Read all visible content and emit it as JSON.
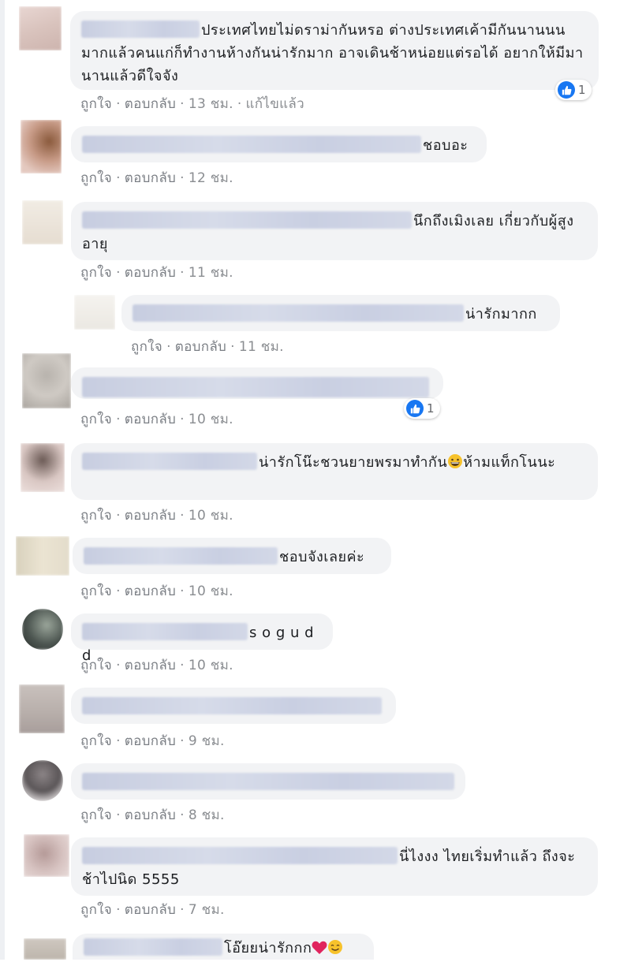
{
  "comments": [
    {
      "text": "ประเทศไทยไม่ดราม่ากันหรอ ต่างประเทศเค้ามีกันนานนน มากแล้วคนแก่ก็ทำงานห้างกันน่ารักมาก อาจเดินช้าหน่อยแต่รอได้ อยากให้มีมานานแล้วดีใจจัง",
      "time": "13 ชม.",
      "edited": "แก้ไขแล้ว",
      "reactions": "1"
    },
    {
      "text": "ชอบอะ",
      "time": "12 ชม."
    },
    {
      "text": "นึกถึงเมิงเลย เกี่ยวกับผู้สูงอายุ",
      "time": "11 ชม."
    },
    {
      "text": "น่ารักมากก",
      "time": "11 ชม."
    },
    {
      "text": "",
      "time": "10 ชม.",
      "reactions": "1"
    },
    {
      "text_before": "น่ารักโน๊ะชวนยายพรมาทำกัน",
      "text_after": "ห้ามแท็กโนนะ",
      "time": "10 ชม."
    },
    {
      "text": "ชอบจังเลยค่ะ",
      "time": "10 ชม."
    },
    {
      "text": "s o g u d d",
      "time": "10 ชม."
    },
    {
      "text": "",
      "time": "9 ชม."
    },
    {
      "text": "",
      "time": "8 ชม."
    },
    {
      "text": "นี่ไงงง ไทยเริ่มทำแล้ว ถึงจะช้าไปนิด 5555",
      "time": "7 ชม."
    },
    {
      "text": "โอ๊ยยน่ารักกก",
      "time": ""
    }
  ],
  "actions": {
    "like": "ถูกใจ",
    "reply": "ตอบกลับ",
    "dot": "·"
  },
  "icons": {
    "like": "thumbs-up-icon",
    "grin": "grinning-emoji",
    "heart": "red-heart-emoji",
    "smile": "smiling-emoji"
  },
  "colors": {
    "bubble": "#f2f3f5",
    "meta": "#8a8d91",
    "like_blue": "#1877f2"
  }
}
